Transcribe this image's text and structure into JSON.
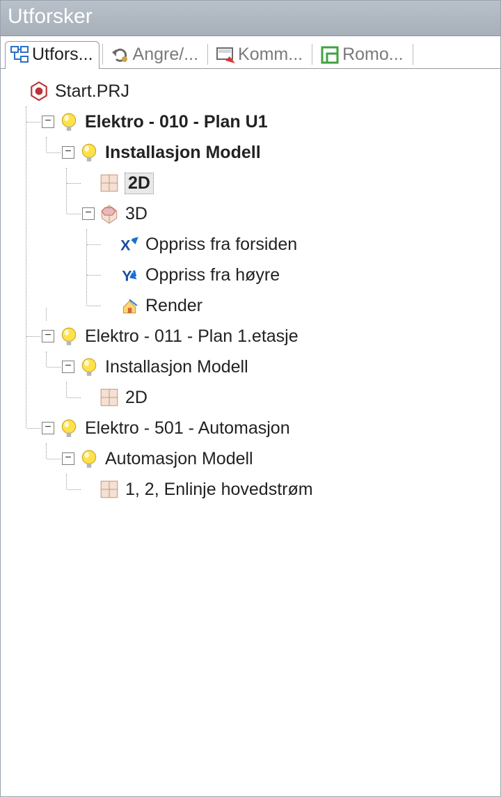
{
  "panel": {
    "title": "Utforsker"
  },
  "tabs": [
    {
      "label": "Utfors...",
      "icon": "tree-icon",
      "active": true
    },
    {
      "label": "Angre/...",
      "icon": "undo-icon",
      "active": false
    },
    {
      "label": "Komm...",
      "icon": "comment-icon",
      "active": false
    },
    {
      "label": "Romo...",
      "icon": "room-icon",
      "active": false
    }
  ],
  "tree": {
    "root": {
      "label": "Start.PRJ"
    },
    "n1": {
      "label": "Elektro - 010 - Plan U1"
    },
    "n1_1": {
      "label": "Installasjon Modell"
    },
    "n1_1_1": {
      "label": "2D"
    },
    "n1_1_2": {
      "label": "3D"
    },
    "n1_1_2_1": {
      "label": "Oppriss fra forsiden"
    },
    "n1_1_2_2": {
      "label": "Oppriss fra høyre"
    },
    "n1_1_2_3": {
      "label": "Render"
    },
    "n2": {
      "label": "Elektro - 011 - Plan 1.etasje"
    },
    "n2_1": {
      "label": "Installasjon Modell"
    },
    "n2_1_1": {
      "label": "2D"
    },
    "n3": {
      "label": "Elektro - 501 - Automasjon"
    },
    "n3_1": {
      "label": "Automasjon Modell"
    },
    "n3_1_1": {
      "label": "1, 2, Enlinje hovedstrøm"
    }
  }
}
